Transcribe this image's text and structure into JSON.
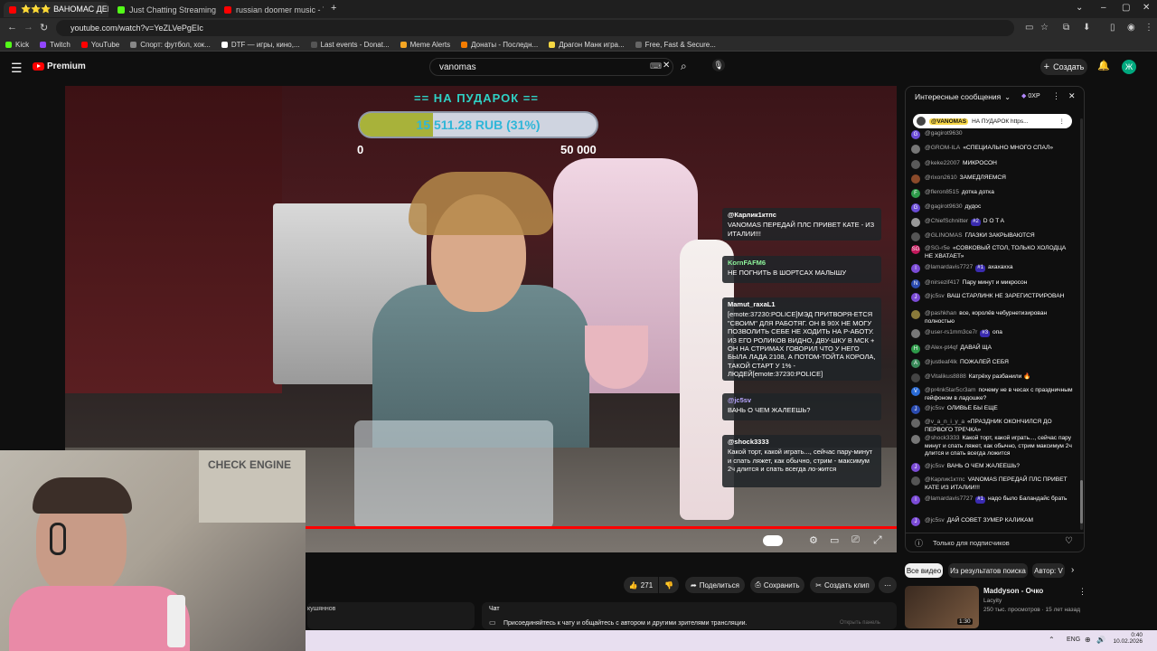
{
  "tabs": [
    {
      "label": "⭐⭐⭐ ВАНОМАС ДЕНЬ",
      "color": "#ff0000",
      "active": true
    },
    {
      "label": "Just Chatting Streaming - Live",
      "color": "#53fc18",
      "active": false
    },
    {
      "label": "russian doomer music - YouTub",
      "color": "#ff0000",
      "active": false
    }
  ],
  "window": {
    "new_tab": "+"
  },
  "address": {
    "url": "youtube.com/watch?v=YeZLVePgEIc"
  },
  "bookmarks": [
    {
      "label": "Kick",
      "color": "#53fc18"
    },
    {
      "label": "Twitch",
      "color": "#9146ff"
    },
    {
      "label": "YouTube",
      "color": "#ff0000"
    },
    {
      "label": "Спорт: футбол, хок...",
      "color": "#888888"
    },
    {
      "label": "DTF — игры, кино,...",
      "color": "#ffffff"
    },
    {
      "label": "Last events - Donat...",
      "color": "#555555"
    },
    {
      "label": "Meme Alerts",
      "color": "#f5a623"
    },
    {
      "label": "Донаты - Последн...",
      "color": "#f57c00"
    },
    {
      "label": "Драгон Манк игра...",
      "color": "#f5d742"
    },
    {
      "label": "Free, Fast & Secure...",
      "color": "#666666"
    }
  ],
  "youtube": {
    "logo": "Premium",
    "search_value": "vanomas",
    "create_label": "Создать",
    "avatar_letter": "Ж",
    "accent": "#ff0000"
  },
  "overlay": {
    "title": "== НА ПУДАРОК ==",
    "progress_text": "15 511.28 RUB (31%)",
    "progress": 0.31,
    "min_label": "0",
    "max_label": "50 000"
  },
  "overlay_chat": [
    {
      "user": "@Карлик1ктпс",
      "text": "VANOMAS ПЕРЕДАЙ ПЛС ПРИВЕТ КАТЕ - ИЗ ИТАЛИИ!!!"
    },
    {
      "user": "KornFAFM6",
      "text": "НЕ ПОГНИТЬ В ШОРТСАХ МАЛЫШУ"
    },
    {
      "user": "Mamut_raxaL1",
      "text": "[emote:37230:POLICE]МЭД ПРИТВОРЯ-ЕТСЯ \"СВОИМ\" ДЛЯ РАБОТЯГ. ОН В 90Х НЕ МОГУ ПОЗВОЛИТЬ СЕБЕ НЕ ХОДИТЬ НА Р-АБОТУ. ИЗ ЕГО РОЛИКОВ ВИДНО, ДВУ-ШКУ В МСК + ОН НА СТРИМАХ ГОВОРИЛ ЧТО У НЕГО БЫЛА ЛАДА 2108, А ПОТОМ-ТОЙТА КОРОЛА, ТАКОЙ СТАРТ У 1% - ЛЮДЕЙ[emote:37230:POLICE]"
    },
    {
      "user": "@jc5sv",
      "text": "ВАНЬ О ЧЕМ ЖАЛЕЕШЬ?"
    },
    {
      "user": "@shock3333",
      "text": "Какой торт, какой играть..., сейчас пару-минут и спать ляжет, как обычно, стрим - максимум 2ч длится и спать всегда ло-жится"
    }
  ],
  "chat": {
    "header": "Интересные сообщения",
    "xp": "0XP",
    "pinned_user": "@VANOMAS",
    "pinned_text": "НА ПУДАРОК https...",
    "footer_placeholder": "Только для подписчиков",
    "messages": [
      {
        "user": "@gagirot9630",
        "text": "",
        "badge": "",
        "color": "#6a4bd6",
        "letter": "G"
      },
      {
        "user": "@GROM-ILA",
        "text": "«СПЕЦИАЛЬНО МНОГО СПАЛ»",
        "badge": "",
        "color": "#777777",
        "letter": ""
      },
      {
        "user": "@keke22007",
        "text": "МИКРОСОН",
        "badge": "",
        "color": "#5a5a5a",
        "letter": ""
      },
      {
        "user": "@rixon2610",
        "text": "ЗАМЕДЛЯЕМСЯ",
        "badge": "",
        "color": "#8a4a2a",
        "letter": ""
      },
      {
        "user": "@fleron8515",
        "text": "дотка дотка",
        "badge": "",
        "color": "#2e9b4a",
        "letter": "F"
      },
      {
        "user": "@gagirot9630",
        "text": "дудос",
        "badge": "",
        "color": "#6a4bd6",
        "letter": "G"
      },
      {
        "user": "@ChiefSchnitter",
        "text": "D O T A",
        "badge": "#2",
        "color": "#999999",
        "letter": ""
      },
      {
        "user": "@GLINOMAS",
        "text": "ГЛАЗКИ ЗАКРЫВАЮТСЯ",
        "badge": "",
        "color": "#555555",
        "letter": ""
      },
      {
        "user": "@SG-r5e",
        "text": "«СОВКОВЫЙ СТОЛ, ТОЛЬКО ХОЛОДЦА НЕ ХВАТАЕТ»",
        "badge": "",
        "color": "#c2185b",
        "letter": "SG"
      },
      {
        "user": "@lamardavis7727",
        "text": "ахахахха",
        "badge": "#1",
        "color": "#7b4bd6",
        "letter": "l"
      },
      {
        "user": "@nirsezif417",
        "text": "Пару минут и микросон",
        "badge": "",
        "color": "#2a4bb0",
        "letter": "N"
      },
      {
        "user": "@jc5sv",
        "text": "ВАШ СТАРЛИНК НЕ ЗАРЕГИСТРИРОВАН",
        "badge": "",
        "color": "#7b4bd6",
        "letter": "J"
      },
      {
        "user": "@pashkhan",
        "text": "все, королёв чебурнетизирован полностью",
        "badge": "",
        "color": "#8a7a3a",
        "letter": ""
      },
      {
        "user": "@user-rs1mm3ce7r",
        "text": "опа",
        "badge": "#3",
        "color": "#777777",
        "letter": ""
      },
      {
        "user": "@Alex-pt4qf",
        "text": "ДАВАЙ ЩА",
        "badge": "",
        "color": "#2e9b4a",
        "letter": "H"
      },
      {
        "user": "@justleaf4lk",
        "text": "ПОЖАЛЕЙ СЕБЯ",
        "badge": "",
        "color": "#3a8a5a",
        "letter": "A"
      },
      {
        "user": "@Vitalikus8888",
        "text": "Катрёху разбанили 🔥",
        "badge": "",
        "color": "#444444",
        "letter": ""
      },
      {
        "user": "@pr4nk5tar5cr3am",
        "text": "почему не в чесах с праздничным гейфоном в ладошке?",
        "badge": "",
        "color": "#2a6bd6",
        "letter": "V"
      },
      {
        "user": "@jc5sv",
        "text": "ОЛИВЬЕ БЫ ЕЩЕ",
        "badge": "",
        "color": "#2a4bb0",
        "letter": "J"
      },
      {
        "user": "@v_a_n_i_y_a",
        "text": "«ПРАЗДНИК ОКОНЧИЛСЯ ДО ПЕРВОГО ТРЕЧКА»",
        "badge": "",
        "color": "#666666",
        "letter": ""
      },
      {
        "user": "@shock3333",
        "text": "Какой торт, какой играть..., сейчас пару минут и спать ляжет, как обычно, стрим максимум 2ч длится и спать всегда ложится",
        "badge": "",
        "color": "#777777",
        "letter": ""
      },
      {
        "user": "@jc5sv",
        "text": "ВАНЬ О ЧЕМ ЖАЛЕЕШЬ?",
        "badge": "",
        "color": "#7b4bd6",
        "letter": "J"
      },
      {
        "user": "@Карлик1ктпс",
        "text": "VANOMAS ПЕРЕДАЙ ПЛС ПРИВЕТ КАТЕ ИЗ ИТАЛИИ!!!",
        "badge": "",
        "color": "#555555",
        "letter": ""
      },
      {
        "user": "@lamardavis7727",
        "text": "надо было Баландайс брать",
        "badge": "#1",
        "color": "#7b4bd6",
        "letter": "l"
      },
      {
        "user": "@jc5sv",
        "text": "ДАЙ СОВЕТ ЗУМЕР КАЛИКАМ",
        "badge": "",
        "color": "#7b4bd6",
        "letter": "J"
      }
    ]
  },
  "actions": {
    "likes": "271",
    "share": "Поделиться",
    "save": "Сохранить",
    "clip": "Создать клип",
    "more": "⋯"
  },
  "below": {
    "channel_text": "кушяннов",
    "chat_label": "Чат",
    "chat_info": "Присоединяйтесь к чату и общайтесь с автором и другими зрителями трансляции.",
    "open_chat": "Открыть панель"
  },
  "rec_tabs": [
    "Все видео",
    "Из результатов поиска",
    "Автор: V"
  ],
  "recommendation": {
    "title": "Maddyson - Очко",
    "channel": "Lacyity",
    "meta": "250 тыс. просмотров · 15 лет назад",
    "duration": "1:30"
  },
  "webcam": {
    "sign": "CHECK ENGINE"
  },
  "tray": {
    "lang": "ENG",
    "time": "0:40",
    "date": "10.02.2026"
  }
}
